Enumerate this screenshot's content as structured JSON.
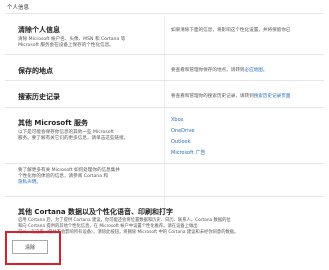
{
  "section_title": "个人信息",
  "rows": [
    {
      "heading": "清除个人信息",
      "desc_lines": [
        "清除 Microsoft 帐户名、头像、MSN 和 Cortana 等",
        "Microsoft 服务会在设备上保存的个性化信息。"
      ],
      "right_lines": [
        "如果清除下面的信息，将影响这个性化设置，并将保留你已"
      ]
    },
    {
      "heading": "保存的地点",
      "right_lines": [
        "要查看和管理你保存的地点，请转到",
        "必应地图。"
      ]
    },
    {
      "heading": "搜索历史记录",
      "right_lines": [
        "要查看和管理你的搜索历史记录，请转到",
        "搜索历史记录页面"
      ]
    },
    {
      "heading": "其他 Microsoft 服务",
      "desc_lines": [
        "以下是可能会保存你信息的其他一些 Microsoft",
        "服务。要了解有关它们的更多信息，请单击这些链接。"
      ],
      "links": [
        "Xbox",
        "OneDrive",
        "Outlook",
        "Microsoft 广告"
      ]
    }
  ],
  "note": {
    "lines": [
      "要了解更多有关 Microsoft 如何处理你的信息集并",
      "个性化你的体验的信息，请参阅 Cortana 和",
      "隐私声明。"
    ]
  },
  "cortana": {
    "heading": "其他 Cortana 数据以及个性化语音、印刷和打字",
    "lines": [
      "启用 Cortana 后，为了提供 Cortana 建议，你可能还会将位置数据和历史、日历、联系人，Cortana 数据的位",
      "和向 Cortana 提供的其他个性化信息，在 Microsoft 帐户中设置个性化推荐。请在设备上做出",
      "可以，在这里（但并不会影响所有设备）。清除此按钮，将删除 Microsoft 中的 Cortana 建议和未经你同意的数据。"
    ],
    "clear_button_label": "清除"
  }
}
